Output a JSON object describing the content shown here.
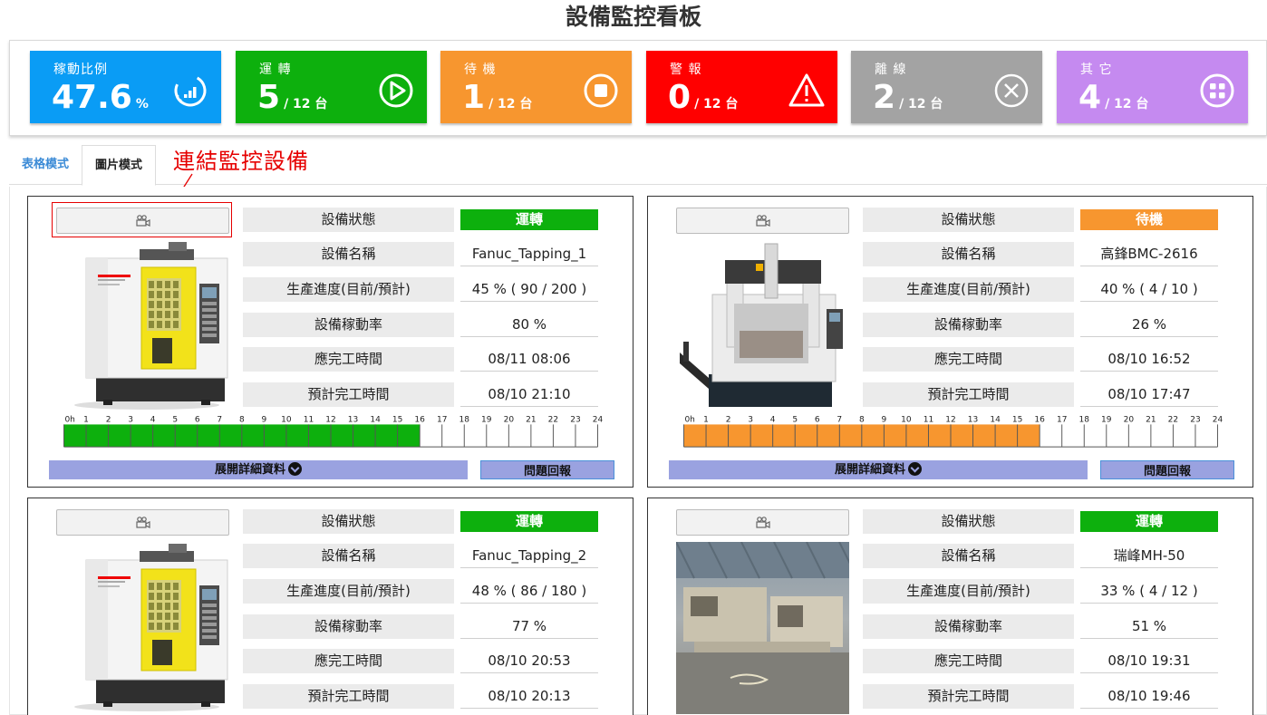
{
  "title": "設備監控看板",
  "summary": [
    {
      "label": "稼動比例",
      "value": "47.6",
      "unit": "%",
      "color": "#0a9cf5",
      "icon": "chart-ring-icon"
    },
    {
      "label": "運 轉",
      "value": "5",
      "unit": "/ 12 台",
      "color": "#0db00d",
      "icon": "play-circle-icon"
    },
    {
      "label": "待 機",
      "value": "1",
      "unit": "/ 12 台",
      "color": "#f7962f",
      "icon": "stop-circle-icon"
    },
    {
      "label": "警 報",
      "value": "0",
      "unit": "/ 12 台",
      "color": "#ff0000",
      "icon": "warning-triangle-icon"
    },
    {
      "label": "離 線",
      "value": "2",
      "unit": "/ 12 台",
      "color": "#a3a3a3",
      "icon": "close-circle-icon"
    },
    {
      "label": "其 它",
      "value": "4",
      "unit": "/ 12 台",
      "color": "#c58af0",
      "icon": "grid-circle-icon"
    }
  ],
  "tabs": {
    "table": "表格模式",
    "image": "圖片模式",
    "active": "image"
  },
  "annotation": "連結監控設備",
  "field_labels": {
    "status": "設備狀態",
    "name": "設備名稱",
    "progress": "生產進度(目前/預計)",
    "utilization": "設備稼動率",
    "due": "應完工時間",
    "eta": "預計完工時間"
  },
  "buttons": {
    "details": "展開詳細資料",
    "report": "問題回報"
  },
  "hours": [
    "0h",
    "1",
    "2",
    "3",
    "4",
    "5",
    "6",
    "7",
    "8",
    "9",
    "10",
    "11",
    "12",
    "13",
    "14",
    "15",
    "16",
    "17",
    "18",
    "19",
    "20",
    "21",
    "22",
    "23",
    "24"
  ],
  "machines": [
    {
      "status": "運轉",
      "status_color": "#0db00d",
      "name": "Fanuc_Tapping_1",
      "progress": "45 % ( 90 / 200 )",
      "utilization": "80 %",
      "due": "08/11 08:06",
      "eta": "08/10 21:10",
      "timeline_hours": 16,
      "timeline_color": "#0db00d",
      "photo": "fanuc-machine"
    },
    {
      "status": "待機",
      "status_color": "#f7962f",
      "name": "高鋒BMC-2616",
      "progress": "40 % ( 4 / 10 )",
      "utilization": "26 %",
      "due": "08/10 16:52",
      "eta": "08/10 17:47",
      "timeline_hours": 16,
      "timeline_color": "#f7962f",
      "photo": "gantry-machine"
    },
    {
      "status": "運轉",
      "status_color": "#0db00d",
      "name": "Fanuc_Tapping_2",
      "progress": "48 % ( 86 / 180 )",
      "utilization": "77 %",
      "due": "08/10 20:53",
      "eta": "08/10 20:13",
      "photo": "fanuc-machine"
    },
    {
      "status": "運轉",
      "status_color": "#0db00d",
      "name": "瑞峰MH-50",
      "progress": "33 % ( 4 / 12 )",
      "utilization": "51 %",
      "due": "08/10 19:31",
      "eta": "08/10 19:46",
      "photo": "factory-photo"
    }
  ]
}
